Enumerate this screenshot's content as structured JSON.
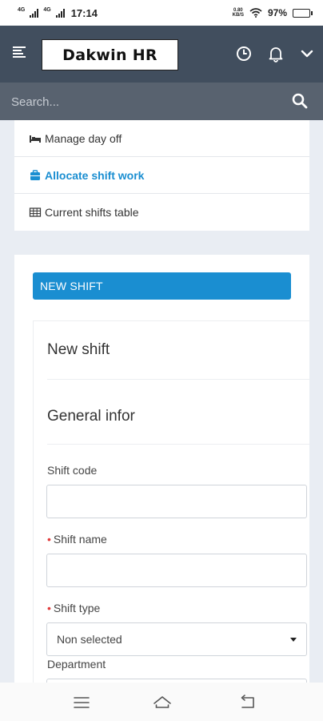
{
  "status_bar": {
    "network_1": "4G",
    "network_2": "4G",
    "time": "17:14",
    "speed_value": "0.80",
    "speed_unit": "KB/S",
    "battery": "97%"
  },
  "header": {
    "logo": "Dakwin HR"
  },
  "search": {
    "placeholder": "Search..."
  },
  "menu": {
    "items": [
      {
        "label": "Manage day off",
        "icon": "bed-icon",
        "active": false
      },
      {
        "label": "Allocate shift work",
        "icon": "briefcase-icon",
        "active": true
      },
      {
        "label": "Current shifts table",
        "icon": "table-icon",
        "active": false
      }
    ]
  },
  "form": {
    "tab_label": "NEW SHIFT",
    "title": "New shift",
    "section_title": "General infor",
    "fields": {
      "shift_code": {
        "label": "Shift code",
        "value": "",
        "required": false
      },
      "shift_name": {
        "label": "Shift name",
        "value": "",
        "required": true
      },
      "shift_type": {
        "label": "Shift type",
        "value": "Non selected",
        "required": true
      },
      "department": {
        "label": "Department",
        "required": false
      }
    },
    "required_mark": "•"
  },
  "colors": {
    "header_bg": "#414e5e",
    "search_bg": "#58626f",
    "accent": "#1a8ed1",
    "required": "#e23b3b",
    "page_bg": "#e9edf3"
  }
}
